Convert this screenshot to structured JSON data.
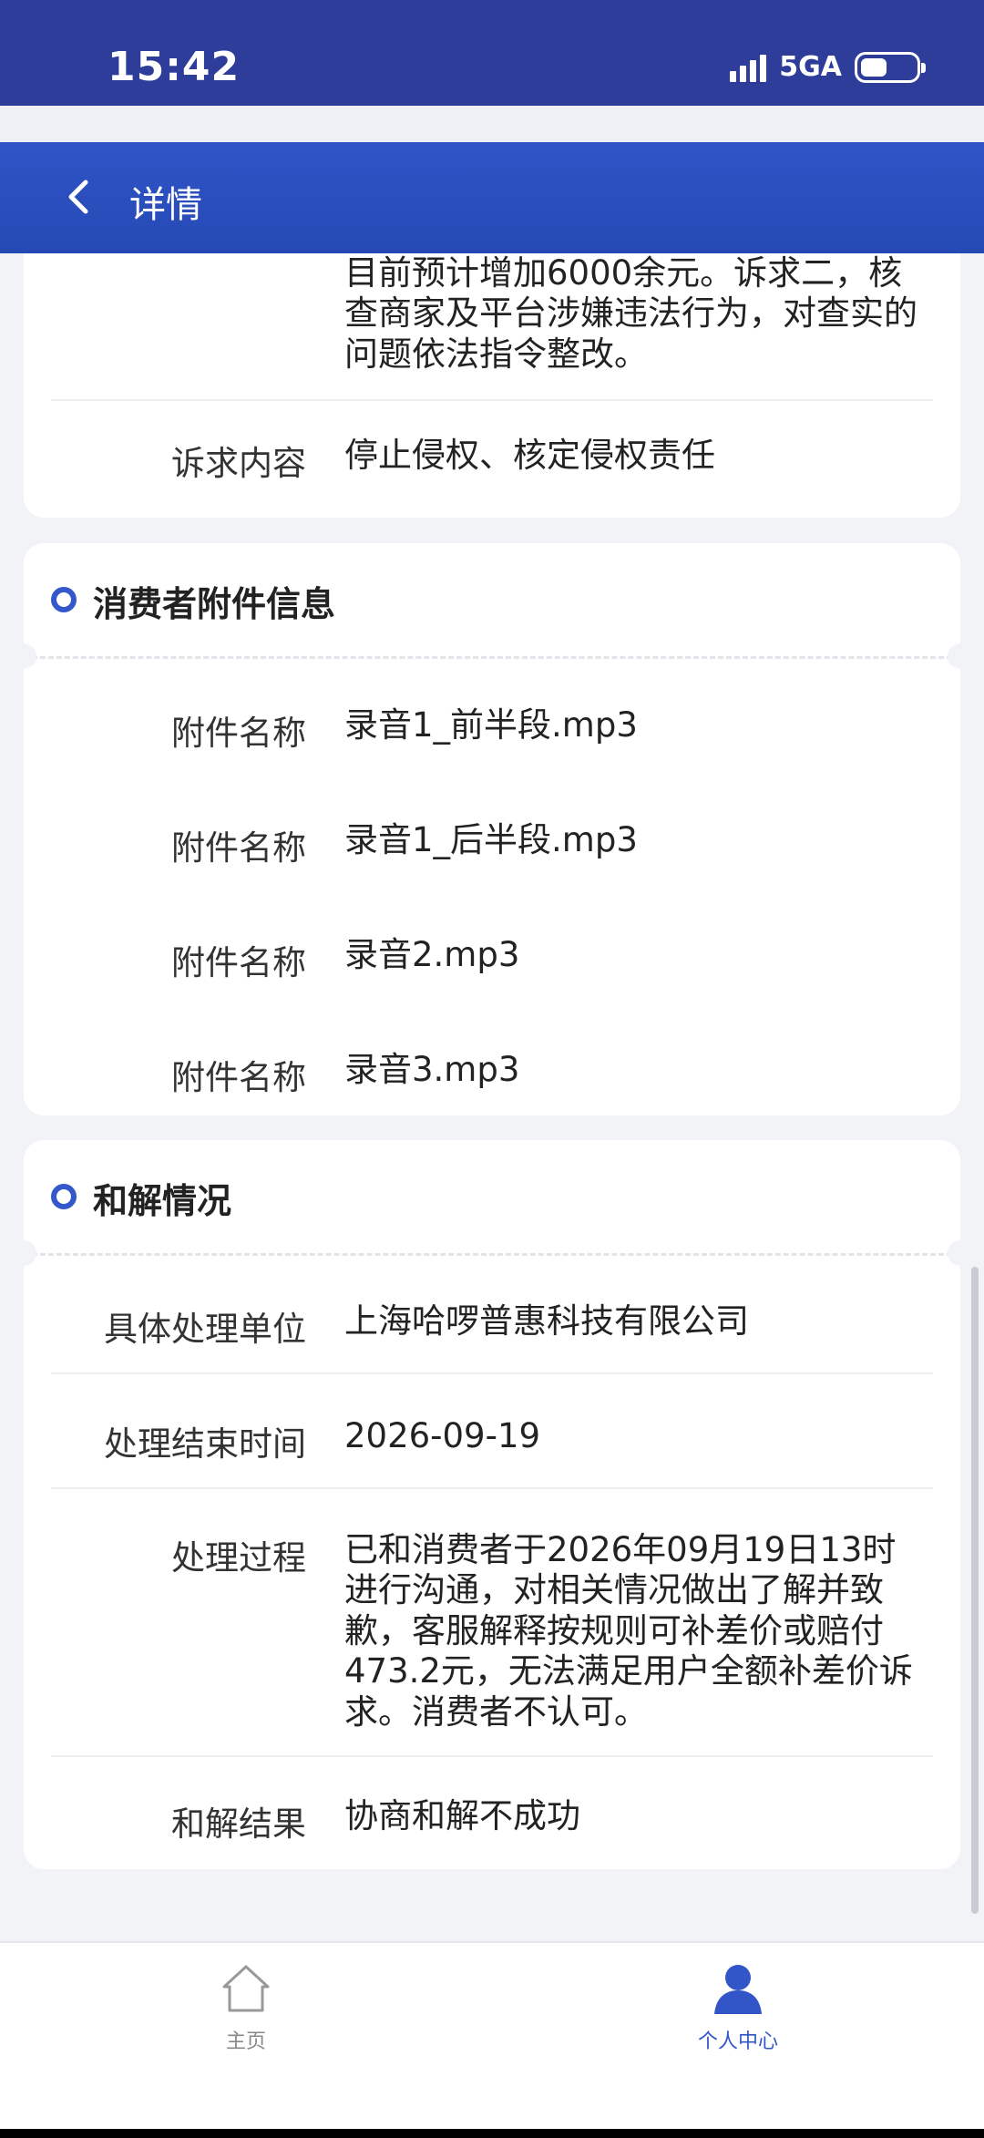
{
  "status_bar": {
    "time": "15:42",
    "network": "5GA"
  },
  "header": {
    "title": "详情"
  },
  "complaint_card": {
    "claim_text_tail": "目前预计增加6000余元。诉求二，核查商家及平台涉嫌违法行为，对查实的问题依法指令整改。",
    "appeal_label": "诉求内容",
    "appeal_value": "停止侵权、核定侵权责任"
  },
  "attachments": {
    "title": "消费者附件信息",
    "items": [
      {
        "label": "附件名称",
        "value": "录音1_前半段.mp3"
      },
      {
        "label": "附件名称",
        "value": "录音1_后半段.mp3"
      },
      {
        "label": "附件名称",
        "value": "录音2.mp3"
      },
      {
        "label": "附件名称",
        "value": "录音3.mp3"
      }
    ]
  },
  "settlement": {
    "title": "和解情况",
    "unit_label": "具体处理单位",
    "unit_value": "上海哈啰普惠科技有限公司",
    "end_time_label": "处理结束时间",
    "end_time_value": "2026-09-19",
    "process_label": "处理过程",
    "process_value": "已和消费者于2026年09月19日13时进行沟通，对相关情况做出了解并致歉，客服解释按规则可补差价或赔付473.2元，无法满足用户全额补差价诉求。消费者不认可。",
    "result_label": "和解结果",
    "result_value": "协商和解不成功"
  },
  "bottom_nav": {
    "home_label": "主页",
    "me_label": "个人中心"
  },
  "colors": {
    "status_bar": "#2e3d9a",
    "nav_bar": "#2549b4",
    "accent": "#3457c9",
    "background": "#f2f3f7"
  }
}
